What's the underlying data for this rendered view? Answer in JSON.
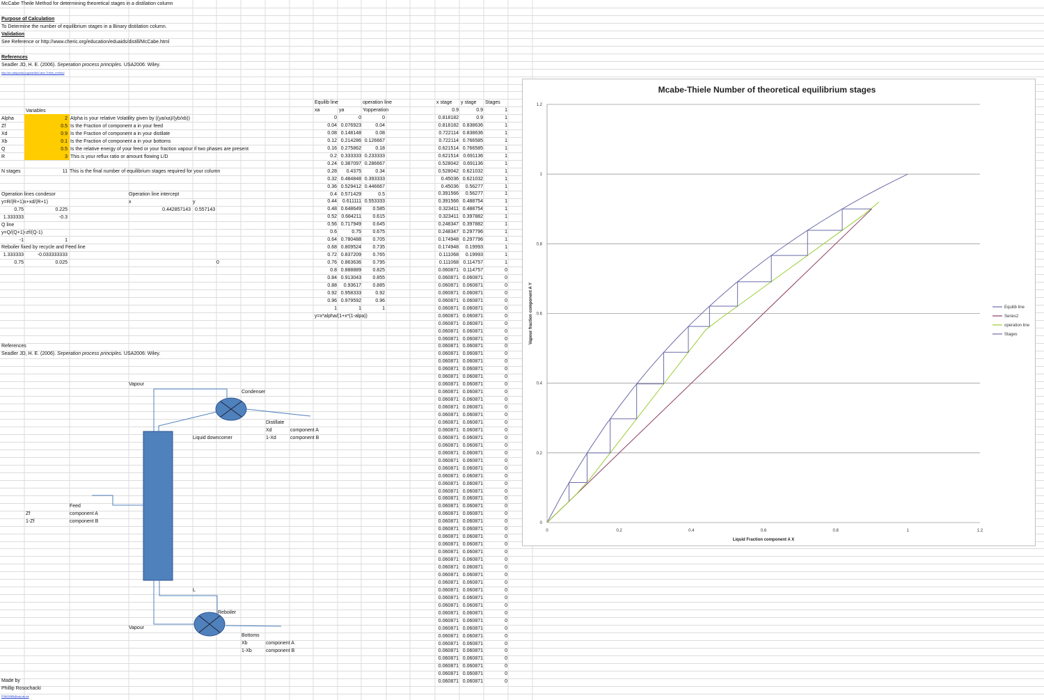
{
  "doc": {
    "title": "McCabe Theile Method for determining theoretical stages in a distilation column",
    "purpose_heading": "Purpose of Calculation",
    "purpose_text": "To Determine the number of equilibrium stages in a Binary distilation column.",
    "validation_heading": "Validation",
    "validation_text": "See Reference or http://www.cheric.org/education/eduaids/distill/McCabe.html",
    "references_heading": "References",
    "reference_author": "Seadler JD, H. E. (2006).",
    "reference_book": "Seperation process principles.",
    "reference_pub": "USA2006: Wiley.",
    "link_small": "http://en.wikipedia.org/wiki/McCabe-Thiele_method",
    "references_label2": "References",
    "made_by_label": "Made by",
    "made_by_name": "Phillip Rosochacki",
    "email": "P0603085@cap.ac.za"
  },
  "variables": {
    "header": "Variables",
    "rows": [
      {
        "name": "Alpha",
        "value": "2",
        "desc": "Alpha is your relative Volatility given by ((ya/xa)/(yb/xb))"
      },
      {
        "name": "Zf",
        "value": "0.5",
        "desc": "Is the Fraction of component a in your feed"
      },
      {
        "name": "Xd",
        "value": "0.9",
        "desc": "Is the Fraction of component a in your distilate"
      },
      {
        "name": "Xb",
        "value": "0.1",
        "desc": "Is the Fraction of component a in your bottoms"
      },
      {
        "name": "Q",
        "value": "0.5",
        "desc": "Is the relative energy of your feed or your fraction vapour if two phases are present"
      },
      {
        "name": "R",
        "value": "3",
        "desc": "This is your reflux ratio or amount flowing L/D"
      }
    ],
    "nstages_label": "N stages",
    "nstages_value": "11",
    "nstages_desc": "This is the final number of equilibrium stages required for your column"
  },
  "oplines": {
    "title": "Operation lines condesor",
    "formula1": "y=R/(R+1)x+xd/(R+1)",
    "r1": [
      "0.75",
      "0.225"
    ],
    "r2": [
      "1.333333",
      "-0.3"
    ],
    "qline_label": "Q line",
    "formula2": "y=Q/(Q+1)-zf/(Q-1)",
    "r3": [
      "-1",
      "1"
    ],
    "reboiler_label": "Reboiler fixed by recycle and Feed line",
    "r4": [
      "1.333333",
      "-0.033333333"
    ],
    "r5": [
      "0.75",
      "0.025"
    ],
    "intercept_title": "Operation line intercept",
    "x_label": "x",
    "y_label": "y",
    "x_val": "0.442857143",
    "y_val": "0.557143",
    "stray_zero": "0"
  },
  "equilib_table": {
    "header1": [
      "Equilib line",
      "",
      "operation line"
    ],
    "header2": [
      "xa",
      "ya",
      "Yopperation"
    ],
    "rows": [
      [
        "0",
        "0",
        "0"
      ],
      [
        "0.04",
        "0.076923",
        "0.04"
      ],
      [
        "0.08",
        "0.148148",
        "0.08"
      ],
      [
        "0.12",
        "0.214286",
        "0.126667"
      ],
      [
        "0.16",
        "0.275862",
        "0.18"
      ],
      [
        "0.2",
        "0.333333",
        "0.233333"
      ],
      [
        "0.24",
        "0.387097",
        "0.286667"
      ],
      [
        "0.28",
        "0.4375",
        "0.34"
      ],
      [
        "0.32",
        "0.484848",
        "0.393333"
      ],
      [
        "0.36",
        "0.529412",
        "0.446667"
      ],
      [
        "0.4",
        "0.571429",
        "0.5"
      ],
      [
        "0.44",
        "0.611111",
        "0.553333"
      ],
      [
        "0.48",
        "0.648649",
        "0.585"
      ],
      [
        "0.52",
        "0.684211",
        "0.615"
      ],
      [
        "0.56",
        "0.717949",
        "0.645"
      ],
      [
        "0.6",
        "0.75",
        "0.675"
      ],
      [
        "0.64",
        "0.780488",
        "0.705"
      ],
      [
        "0.68",
        "0.809524",
        "0.735"
      ],
      [
        "0.72",
        "0.837209",
        "0.765"
      ],
      [
        "0.76",
        "0.863636",
        "0.795"
      ],
      [
        "0.8",
        "0.888889",
        "0.825"
      ],
      [
        "0.84",
        "0.913043",
        "0.855"
      ],
      [
        "0.88",
        "0.93617",
        "0.885"
      ],
      [
        "0.92",
        "0.958333",
        "0.92"
      ],
      [
        "0.96",
        "0.979592",
        "0.96"
      ],
      [
        "1",
        "1",
        "1"
      ]
    ],
    "formula": "y=x*alpha/(1+x*(1-alpa))"
  },
  "stage_table": {
    "header": [
      "x stage",
      "y stage",
      "Stages"
    ],
    "rows": [
      [
        "0.9",
        "0.9",
        "1"
      ],
      [
        "0.818182",
        "0.9",
        "1"
      ],
      [
        "0.818182",
        "0.838636",
        "1"
      ],
      [
        "0.722114",
        "0.838636",
        "1"
      ],
      [
        "0.722114",
        "0.766585",
        "1"
      ],
      [
        "0.621514",
        "0.766585",
        "1"
      ],
      [
        "0.621514",
        "0.691136",
        "1"
      ],
      [
        "0.528042",
        "0.691136",
        "1"
      ],
      [
        "0.528042",
        "0.621032",
        "1"
      ],
      [
        "0.45036",
        "0.621032",
        "1"
      ],
      [
        "0.45036",
        "0.56277",
        "1"
      ],
      [
        "0.391566",
        "0.56277",
        "1"
      ],
      [
        "0.391566",
        "0.488754",
        "1"
      ],
      [
        "0.323411",
        "0.488754",
        "1"
      ],
      [
        "0.323411",
        "0.397882",
        "1"
      ],
      [
        "0.248347",
        "0.397882",
        "1"
      ],
      [
        "0.248347",
        "0.297796",
        "1"
      ],
      [
        "0.174948",
        "0.297796",
        "1"
      ],
      [
        "0.174948",
        "0.19993",
        "1"
      ],
      [
        "0.111068",
        "0.19993",
        "1"
      ],
      [
        "0.111068",
        "0.114757",
        "1"
      ],
      [
        "0.060871",
        "0.114757",
        "0"
      ]
    ],
    "filler": [
      "0.060871",
      "0.060871",
      "0"
    ],
    "filler_count": 54
  },
  "diagram": {
    "vapour_top": "Vapour",
    "condenser": "Condenser",
    "distillate": "Distillate",
    "xd": "Xd",
    "one_minus_xd": "1-Xd",
    "comp_a": "component A",
    "comp_b": "component B",
    "liquid_downcomer": "Liquid downcomer",
    "feed": "Feed",
    "zf": "Zf",
    "one_minus_zf": "1-Zf",
    "L": "L",
    "reboiler": "Reboiler",
    "vapour_bottom": "Vapour",
    "bottoms": "Bottoms",
    "xb": "Xb",
    "one_minus_xb": "1-Xb",
    "column_color": "#4f81bd"
  },
  "chart_data": {
    "type": "line",
    "title": "Mcabe-Thiele Number of theoretical equilibrium stages",
    "xlabel": "Liquid Fraction component A X",
    "ylabel": "Vapour fraction component A Y",
    "xlim": [
      0,
      1.2
    ],
    "ylim": [
      0,
      1.2
    ],
    "xticks": [
      "0",
      "0.2",
      "0.4",
      "0.6",
      "0.8",
      "1",
      "1.2"
    ],
    "yticks": [
      "0",
      "0.2",
      "0.4",
      "0.6",
      "0.8",
      "1",
      "1.2"
    ],
    "grid": "horizontal",
    "legend_position": "right",
    "series": [
      {
        "name": "Equilib line",
        "color": "#6a6aa8",
        "x": [
          0,
          0.04,
          0.08,
          0.12,
          0.16,
          0.2,
          0.24,
          0.28,
          0.32,
          0.36,
          0.4,
          0.44,
          0.48,
          0.52,
          0.56,
          0.6,
          0.64,
          0.68,
          0.72,
          0.76,
          0.8,
          0.84,
          0.88,
          0.92,
          0.96,
          1
        ],
        "y": [
          0,
          0.076923,
          0.148148,
          0.214286,
          0.275862,
          0.333333,
          0.387097,
          0.4375,
          0.484848,
          0.529412,
          0.571429,
          0.611111,
          0.648649,
          0.684211,
          0.717949,
          0.75,
          0.780488,
          0.809524,
          0.837209,
          0.863636,
          0.888889,
          0.913043,
          0.93617,
          0.958333,
          0.979592,
          1
        ]
      },
      {
        "name": "Series2",
        "color": "#8b3a62",
        "x": [
          0,
          0.9
        ],
        "y": [
          0,
          0.9
        ]
      },
      {
        "name": "operation line",
        "color": "#9acd32",
        "x": [
          0,
          0.04,
          0.08,
          0.12,
          0.16,
          0.2,
          0.24,
          0.28,
          0.32,
          0.36,
          0.4,
          0.44,
          0.48,
          0.52,
          0.56,
          0.6,
          0.64,
          0.68,
          0.72,
          0.76,
          0.8,
          0.84,
          0.88,
          0.92
        ],
        "y": [
          0,
          0.04,
          0.08,
          0.126667,
          0.18,
          0.233333,
          0.286667,
          0.34,
          0.393333,
          0.446667,
          0.5,
          0.553333,
          0.585,
          0.615,
          0.645,
          0.675,
          0.705,
          0.735,
          0.765,
          0.795,
          0.825,
          0.855,
          0.885,
          0.92
        ]
      },
      {
        "name": "Stages",
        "color": "#6a6aa8",
        "x": [
          0.9,
          0.818182,
          0.818182,
          0.722114,
          0.722114,
          0.621514,
          0.621514,
          0.528042,
          0.528042,
          0.45036,
          0.45036,
          0.391566,
          0.391566,
          0.323411,
          0.323411,
          0.248347,
          0.248347,
          0.174948,
          0.174948,
          0.111068,
          0.111068,
          0.060871,
          0.060871
        ],
        "y": [
          0.9,
          0.9,
          0.838636,
          0.838636,
          0.766585,
          0.766585,
          0.691136,
          0.691136,
          0.621032,
          0.621032,
          0.56277,
          0.56277,
          0.488754,
          0.488754,
          0.397882,
          0.397882,
          0.297796,
          0.297796,
          0.19993,
          0.19993,
          0.114757,
          0.114757,
          0.060871
        ]
      }
    ]
  }
}
